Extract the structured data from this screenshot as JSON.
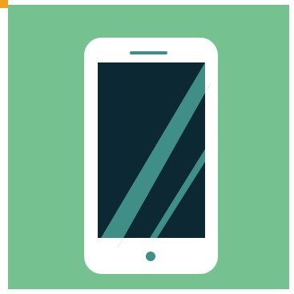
{
  "image": {
    "subject": "smartphone-icon",
    "colors": {
      "background": "#75c190",
      "corner_accent": "#f0a21f",
      "phone_body": "#ffffff",
      "screen": "#0c2833",
      "screen_reflection": "#3f8f86",
      "speaker": "#3f8f86",
      "home_button": "#3f8f86"
    }
  }
}
